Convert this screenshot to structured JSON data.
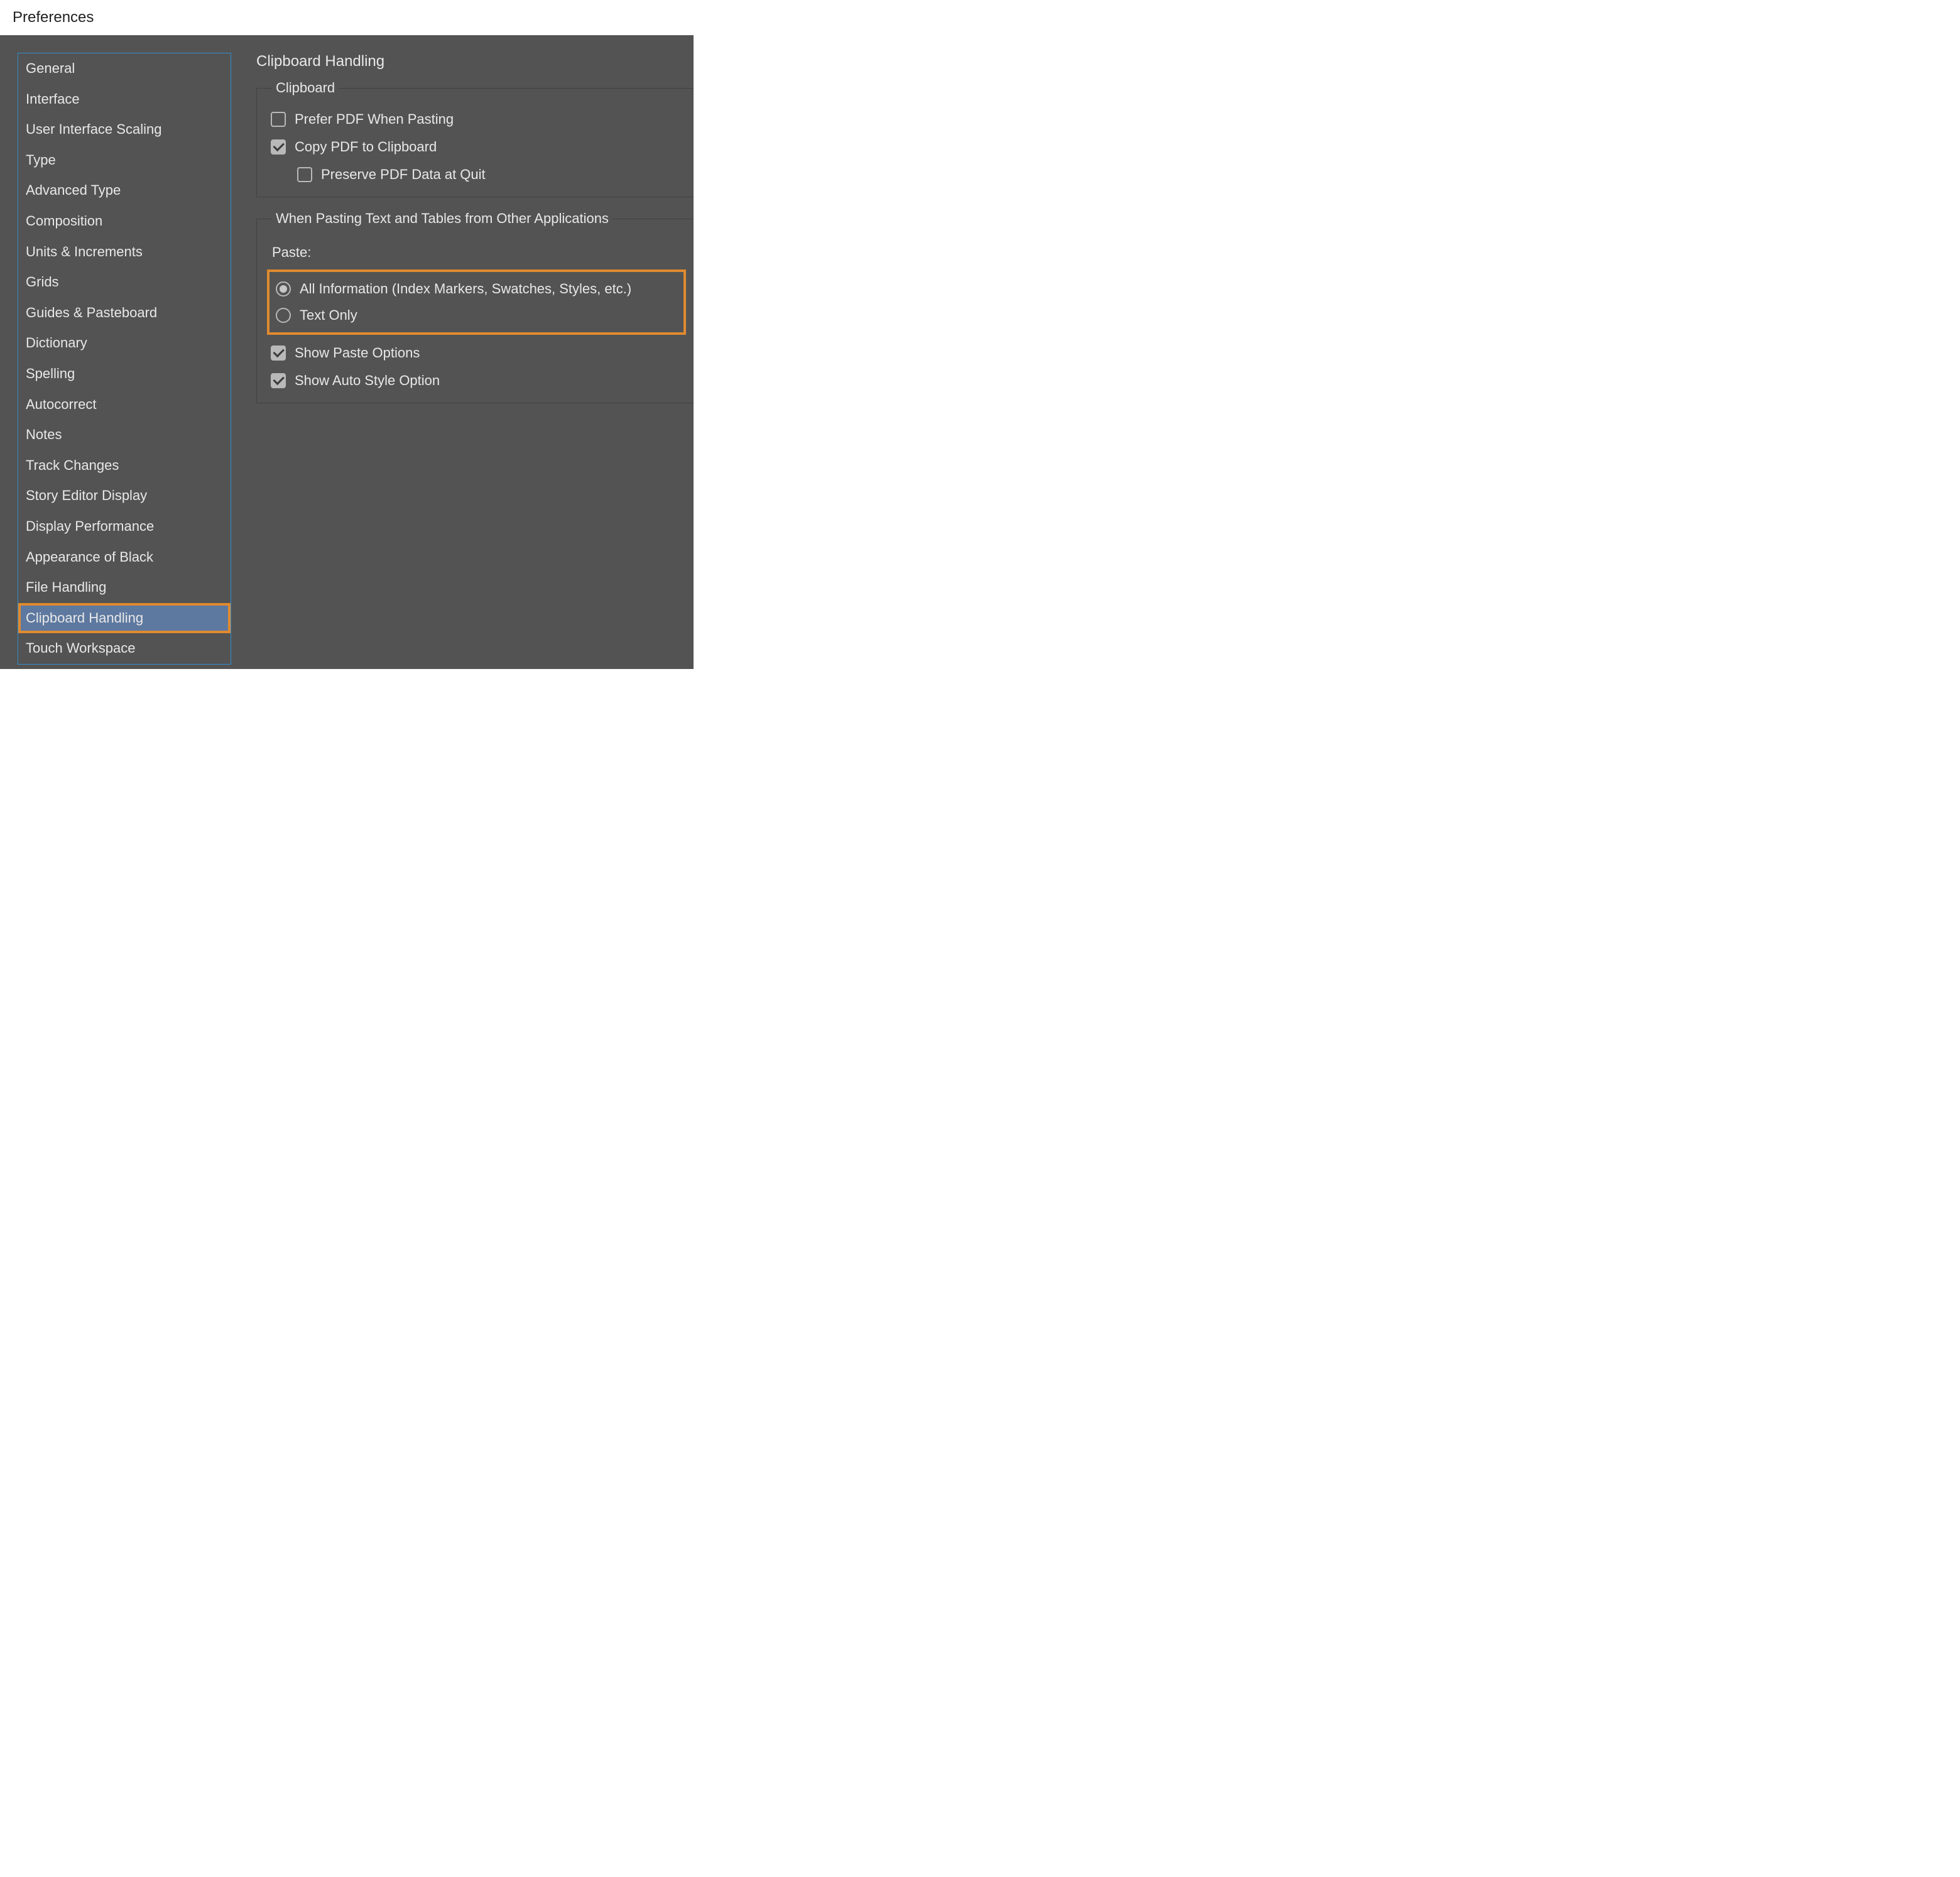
{
  "window": {
    "title": "Preferences"
  },
  "sidebar": {
    "items": [
      {
        "label": "General"
      },
      {
        "label": "Interface"
      },
      {
        "label": "User Interface Scaling"
      },
      {
        "label": "Type"
      },
      {
        "label": "Advanced Type"
      },
      {
        "label": "Composition"
      },
      {
        "label": "Units & Increments"
      },
      {
        "label": "Grids"
      },
      {
        "label": "Guides & Pasteboard"
      },
      {
        "label": "Dictionary"
      },
      {
        "label": "Spelling"
      },
      {
        "label": "Autocorrect"
      },
      {
        "label": "Notes"
      },
      {
        "label": "Track Changes"
      },
      {
        "label": "Story Editor Display"
      },
      {
        "label": "Display Performance"
      },
      {
        "label": "Appearance of Black"
      },
      {
        "label": "File Handling"
      },
      {
        "label": "Clipboard Handling"
      },
      {
        "label": "Touch Workspace"
      }
    ]
  },
  "panel": {
    "title": "Clipboard Handling",
    "group1": {
      "legend": "Clipboard",
      "opt_prefer_pdf": "Prefer PDF When Pasting",
      "opt_copy_pdf": "Copy PDF to Clipboard",
      "opt_preserve_pdf": "Preserve PDF Data at Quit"
    },
    "group2": {
      "legend": "When Pasting Text and Tables from Other Applications",
      "paste_label": "Paste:",
      "radio_all": "All Information (Index Markers, Swatches, Styles, etc.)",
      "radio_text_only": "Text Only",
      "opt_show_paste": "Show Paste Options",
      "opt_show_autostyle": "Show Auto Style Option"
    }
  }
}
